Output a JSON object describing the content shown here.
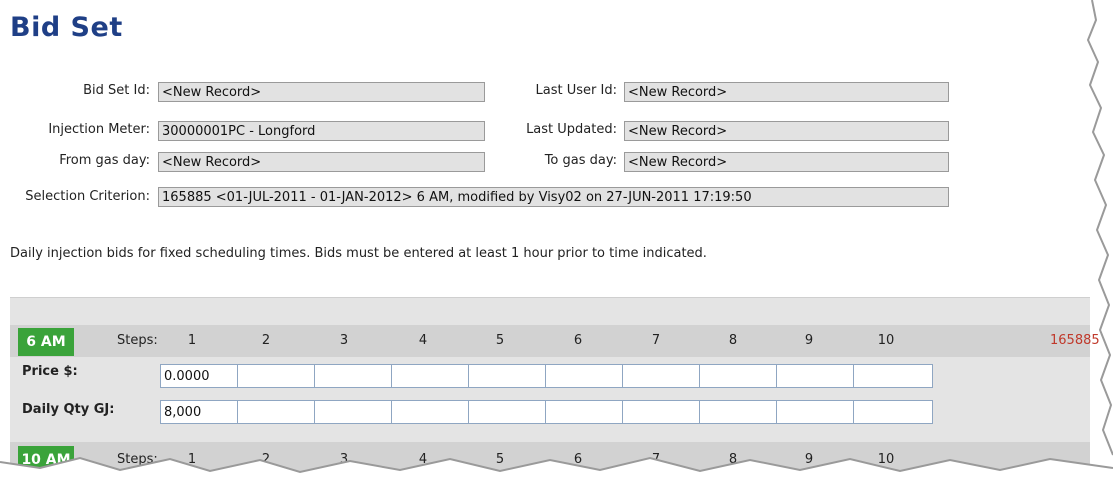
{
  "title": "Bid Set",
  "fields_left": [
    {
      "label": "Bid Set Id:",
      "value": "<New Record>"
    },
    {
      "label": "Injection Meter:",
      "value": "30000001PC - Longford"
    },
    {
      "label": "From gas day:",
      "value": "<New Record>"
    }
  ],
  "fields_right": [
    {
      "label": "Last User Id:",
      "value": "<New Record>"
    },
    {
      "label": "Last Updated:",
      "value": "<New Record>"
    },
    {
      "label": "To gas day:",
      "value": "<New Record>"
    }
  ],
  "selection": {
    "label": "Selection Criterion:",
    "value": "165885 <01-JUL-2011 - 01-JAN-2012> 6 AM, modified by Visy02 on 27-JUN-2011 17:19:50"
  },
  "note": "Daily injection bids for fixed scheduling times. Bids must be entered at least 1 hour prior to time indicated.",
  "schedule_6am": {
    "time": "6 AM",
    "steps_label": "Steps:",
    "steps": [
      "1",
      "2",
      "3",
      "4",
      "5",
      "6",
      "7",
      "8",
      "9",
      "10"
    ],
    "record_id": "165885",
    "price_label": "Price $:",
    "price_values": [
      "0.0000",
      "",
      "",
      "",
      "",
      "",
      "",
      "",
      "",
      ""
    ],
    "qty_label": "Daily Qty GJ:",
    "qty_values": [
      "8,000",
      "",
      "",
      "",
      "",
      "",
      "",
      "",
      "",
      ""
    ]
  },
  "schedule_10am": {
    "time": "10 AM",
    "steps_label": "Steps:",
    "steps": [
      "1",
      "2",
      "3",
      "4",
      "5",
      "6",
      "7",
      "8",
      "9",
      "10"
    ]
  }
}
